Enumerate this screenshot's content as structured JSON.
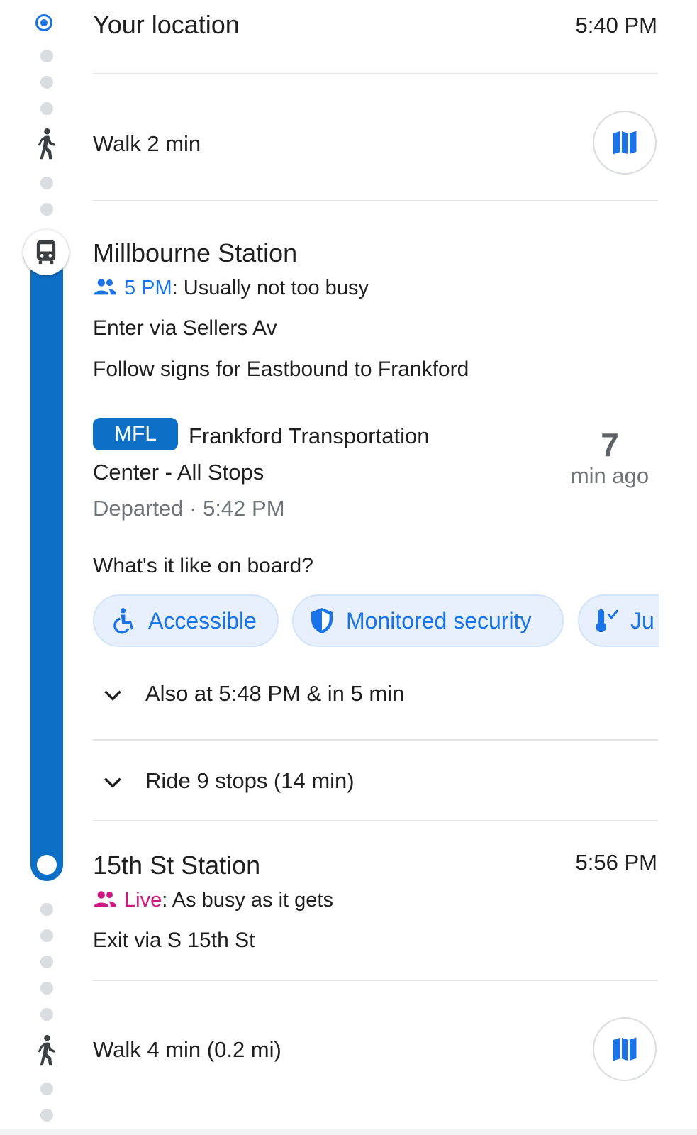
{
  "origin": {
    "label": "Your location",
    "time": "5:40 PM"
  },
  "walk1": {
    "label": "Walk 2 min"
  },
  "board_station": {
    "name": "Millbourne Station",
    "busy_time": "5 PM",
    "busy_text": ": Usually not too busy",
    "enter": "Enter via Sellers Av",
    "follow": "Follow signs for Eastbound to Frankford"
  },
  "route": {
    "badge": "MFL",
    "badge_color": "#0e6fc6",
    "headsign_line1": "Frankford Transportation",
    "headsign_line2": "Center - All Stops",
    "status": "Departed · 5:42 PM",
    "ago_value": "7",
    "ago_unit": "min ago"
  },
  "onboard": {
    "question": "What's it like on board?",
    "chips": [
      {
        "label": "Accessible",
        "icon": "wheelchair-icon"
      },
      {
        "label": "Monitored security",
        "icon": "shield-icon"
      },
      {
        "label": "Ju",
        "icon": "thermometer-check-icon"
      }
    ]
  },
  "also_at": "Also at 5:48 PM & in 5 min",
  "ride": "Ride 9 stops (14 min)",
  "alight_station": {
    "name": "15th St Station",
    "time": "5:56 PM",
    "live_label": "Live",
    "live_text": ": As busy as it gets",
    "exit": "Exit via S 15th St"
  },
  "walk2": {
    "label": "Walk 4 min (0.2 mi)"
  },
  "colors": {
    "accent": "#1a73e8",
    "line": "#0e6fc6",
    "live": "#d01884"
  }
}
